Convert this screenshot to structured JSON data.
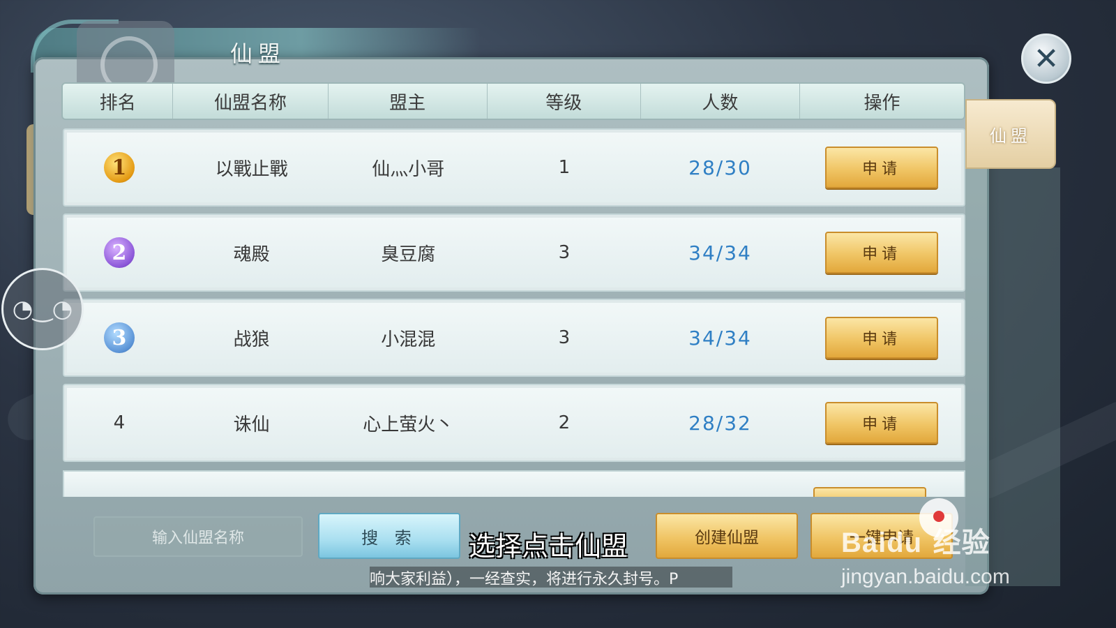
{
  "window": {
    "title": "仙盟",
    "side_tab_label": "仙盟"
  },
  "table": {
    "headers": [
      "排名",
      "仙盟名称",
      "盟主",
      "等级",
      "人数",
      "操作"
    ],
    "rows": [
      {
        "rank": "1",
        "name": "以戰止戰",
        "leader": "仙灬小哥",
        "level": "1",
        "members": "28/30",
        "action": "申请"
      },
      {
        "rank": "2",
        "name": "魂殿",
        "leader": "臭豆腐",
        "level": "3",
        "members": "34/34",
        "action": "申请"
      },
      {
        "rank": "3",
        "name": "战狼",
        "leader": "小混混",
        "level": "3",
        "members": "34/34",
        "action": "申请"
      },
      {
        "rank": "4",
        "name": "诛仙",
        "leader": "心上萤火丶",
        "level": "2",
        "members": "28/32",
        "action": "申请"
      }
    ]
  },
  "footer": {
    "search_placeholder": "输入仙盟名称",
    "search_label": "搜 索",
    "create_label": "创建仙盟",
    "one_click_label": "一键申请"
  },
  "overlay": {
    "subtitle": "选择点击仙盟",
    "ticker": "响大家利益），一经查实，将进行永久封号。P",
    "watermark_logo_a": "Bai",
    "watermark_logo_b": "du",
    "watermark_logo_c": "经验",
    "watermark_url": "jingyan.baidu.com"
  },
  "icons": {
    "close": "close-icon",
    "rank_medals": [
      "gold-medal-icon",
      "purple-medal-icon",
      "blue-medal-icon"
    ]
  },
  "colors": {
    "member_count": "#2f7fc4",
    "button_gold": "#f0c565",
    "search_blue": "#a9dff0"
  }
}
